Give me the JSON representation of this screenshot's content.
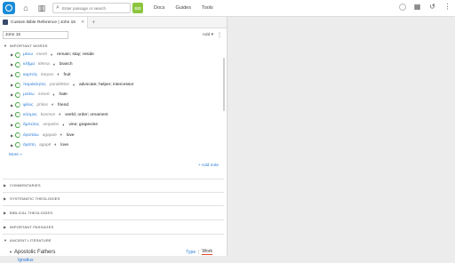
{
  "search": {
    "placeholder": "Enter passage or search",
    "go_label": "GO"
  },
  "nav": {
    "docs": "Docs",
    "guides": "Guides",
    "tools": "Tools"
  },
  "tab": {
    "title": "Custom Bible Reference | John 15"
  },
  "reference": {
    "value": "John 15",
    "add_label": "Add ▾",
    "more": "⋮"
  },
  "important_words": {
    "header": "IMPORTANT WORDS",
    "items": [
      {
        "lemma": "μένω",
        "translit": "menō",
        "gloss": "remain; stay; reside"
      },
      {
        "lemma": "κλῆμα",
        "translit": "klēma",
        "gloss": "branch"
      },
      {
        "lemma": "καρπός",
        "translit": "karpos",
        "gloss": "fruit"
      },
      {
        "lemma": "παράκλητος",
        "translit": "paraklētos",
        "gloss": "advocate; helper; intercessor"
      },
      {
        "lemma": "μισέω",
        "translit": "miseō",
        "gloss": "hate"
      },
      {
        "lemma": "φίλος",
        "translit": "philos",
        "gloss": "friend"
      },
      {
        "lemma": "κόσμος",
        "translit": "kosmos",
        "gloss": "world; order; ornament"
      },
      {
        "lemma": "ἄμπελος",
        "translit": "ampelos",
        "gloss": "vine; grapevine"
      },
      {
        "lemma": "ἀγαπάω",
        "translit": "agapaō",
        "gloss": "love"
      },
      {
        "lemma": "ἀγάπη",
        "translit": "agapē",
        "gloss": "love"
      }
    ],
    "more": "More »",
    "add_note": "+ Add note"
  },
  "sections": {
    "commentaries": "COMMENTARIES",
    "systematic": "SYSTEMATIC THEOLOGIES",
    "biblical": "BIBLICAL THEOLOGIES",
    "passages": "IMPORTANT PASSAGES",
    "ancient": "ANCIENT LITERATURE"
  },
  "ancient": {
    "group": "Apostolic Fathers",
    "type_label": "Type",
    "separator": "|",
    "work_label": "Work",
    "sub": "Ignatius"
  },
  "colors": {
    "accent": "#2a7bd8",
    "go": "#8cc63f",
    "logo": "#1a8cd8"
  }
}
